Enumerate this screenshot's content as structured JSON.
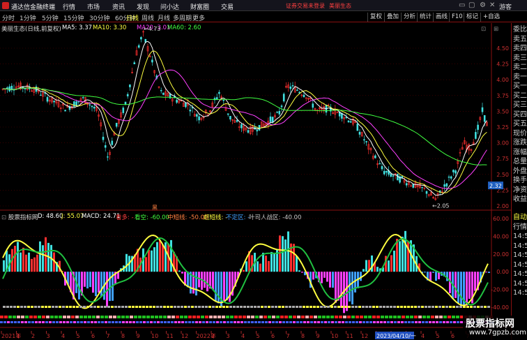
{
  "app": {
    "title": "通达信金融终端"
  },
  "menu": [
    "行情",
    "市场",
    "资讯",
    "发现",
    "问小达",
    "财富圈",
    "交易"
  ],
  "top_notice": "证券交易未登录",
  "top_stock": "美丽生态",
  "top_user": "游客",
  "periods": [
    "分时",
    "1分钟",
    "5分钟",
    "15分钟",
    "30分钟",
    "60分钟",
    "日线",
    "周线",
    "月线",
    "多周期",
    "更多"
  ],
  "active_period": "日线",
  "tool_buttons": [
    "复权",
    "叠加",
    "分析",
    "统计",
    "画线",
    "F10",
    "标记",
    "+自选"
  ],
  "chart": {
    "header_title": "美丽生态(日线,前复权)",
    "ma_labels": [
      {
        "text": "MA5: 3.37",
        "color": "#ffffff"
      },
      {
        "text": "MA10: 3.30",
        "color": "#ffff40"
      },
      {
        "text": "MA20: 3.01",
        "color": "#ff40ff"
      },
      {
        "text": "MA60: 2.60",
        "color": "#40ff40"
      }
    ],
    "price_axis": [
      "4.50",
      "4.25",
      "4.00",
      "3.75",
      "3.50",
      "3.25",
      "3.00",
      "2.75",
      "2.50",
      "2.25",
      "2.00"
    ],
    "current_price_tag": "2.32",
    "high_marker": "4.73",
    "low_marker": "2.05",
    "event_marker": "黑"
  },
  "indicator": {
    "name": "股票指标网",
    "values": [
      {
        "text": "D: 48.60",
        "color": "#ffffff"
      },
      {
        "text": "J: 55.07",
        "color": "#ffff40"
      },
      {
        "text": "MACD: 24.71",
        "color": "#ffffff"
      },
      {
        "text": "看多: -",
        "color": "#ff4040"
      },
      {
        "text": "看空: -60.00",
        "color": "#40ff40"
      },
      {
        "text": "中短线: -50.00",
        "color": "#ff8040"
      },
      {
        "text": "超短线: -",
        "color": "#ffff40"
      },
      {
        "text": "不定区: -",
        "color": "#40a0ff"
      },
      {
        "text": "叶司人战区: -40.00",
        "color": "#cccccc"
      }
    ],
    "axis": [
      "60.00",
      "40.00",
      "20.00",
      "0.00",
      "-20.00",
      "-40.00"
    ]
  },
  "date_axis": {
    "labels": [
      "2021年",
      "1",
      "2",
      "3",
      "4",
      "5",
      "6",
      "7",
      "8",
      "9",
      "10",
      "11",
      "12",
      "2022年",
      "2",
      "3",
      "4",
      "5",
      "6",
      "7",
      "8",
      "9",
      "10",
      "11",
      "12",
      "2023年",
      "2",
      "3",
      "4",
      "5",
      "6",
      "7"
    ],
    "cursor_date": "2023/04/10/一"
  },
  "side_panel": {
    "items": [
      {
        "text": "委比",
        "color": "#cccccc"
      },
      {
        "text": "卖五",
        "color": "#cccccc"
      },
      {
        "text": "卖四",
        "color": "#cccccc"
      },
      {
        "text": "卖三",
        "color": "#cccccc"
      },
      {
        "text": "卖二",
        "color": "#cccccc"
      },
      {
        "text": "卖一",
        "color": "#cccccc"
      },
      {
        "text": "买一",
        "color": "#cccccc"
      },
      {
        "text": "买二",
        "color": "#cccccc"
      },
      {
        "text": "买三",
        "color": "#cccccc"
      },
      {
        "text": "买四",
        "color": "#cccccc"
      },
      {
        "text": "买五",
        "color": "#cccccc"
      },
      {
        "text": "现价",
        "color": "#cccccc"
      },
      {
        "text": "涨跌",
        "color": "#cccccc"
      },
      {
        "text": "涨幅",
        "color": "#cccccc"
      },
      {
        "text": "总量",
        "color": "#cccccc"
      },
      {
        "text": "外盘",
        "color": "#cccccc"
      },
      {
        "text": "换手",
        "color": "#cccccc"
      },
      {
        "text": "净资",
        "color": "#cccccc"
      },
      {
        "text": "收益",
        "color": "#cccccc"
      },
      {
        "text": "自动",
        "color": "#ffff40"
      },
      {
        "text": "行情",
        "color": "#cccccc"
      },
      {
        "text": "14:5",
        "color": "#cccccc"
      },
      {
        "text": "14:5",
        "color": "#cccccc"
      },
      {
        "text": "14:5",
        "color": "#cccccc"
      },
      {
        "text": "14:5",
        "color": "#cccccc"
      },
      {
        "text": "14:5",
        "color": "#cccccc"
      },
      {
        "text": "14:5",
        "color": "#cccccc"
      },
      {
        "text": "14:5",
        "color": "#cccccc"
      }
    ]
  },
  "watermark": {
    "title": "股票指标网",
    "url": "www.7gpzb.com"
  },
  "colors": {
    "up": "#ff3030",
    "down": "#40e0e0",
    "grid": "#5a0000",
    "border": "#8a1010"
  }
}
